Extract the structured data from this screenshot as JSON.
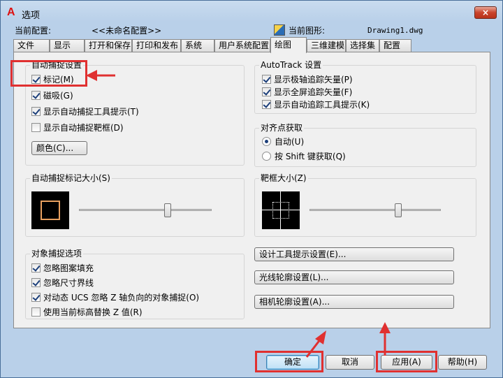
{
  "window": {
    "title": "选项",
    "close_symbol": "×"
  },
  "info": {
    "current_config_label": "当前配置:",
    "current_config_value": "<<未命名配置>>",
    "current_drawing_label": "当前图形:",
    "current_drawing_value": "Drawing1.dwg"
  },
  "tabs": [
    "文件",
    "显示",
    "打开和保存",
    "打印和发布",
    "系统",
    "用户系统配置",
    "绘图",
    "三维建模",
    "选择集",
    "配置"
  ],
  "active_tab": "绘图",
  "autosnap": {
    "title": "自动捕捉设置",
    "options": [
      {
        "label": "标记(M)",
        "checked": true
      },
      {
        "label": "磁吸(G)",
        "checked": true
      },
      {
        "label": "显示自动捕捉工具提示(T)",
        "checked": true
      },
      {
        "label": "显示自动捕捉靶框(D)",
        "checked": false
      }
    ],
    "color_button": "颜色(C)..."
  },
  "autotrack": {
    "title": "AutoTrack 设置",
    "options": [
      {
        "label": "显示极轴追踪矢量(P)",
        "checked": true
      },
      {
        "label": "显示全屏追踪矢量(F)",
        "checked": true
      },
      {
        "label": "显示自动追踪工具提示(K)",
        "checked": true
      }
    ]
  },
  "alignment": {
    "title": "对齐点获取",
    "options": [
      {
        "label": "自动(U)",
        "selected": true
      },
      {
        "label": "按 Shift 键获取(Q)",
        "selected": false
      }
    ]
  },
  "marker_size": {
    "title": "自动捕捉标记大小(S)",
    "level": 0.66,
    "marker_color": "#e8a060"
  },
  "aperture_size": {
    "title": "靶框大小(Z)",
    "level": 0.68
  },
  "osnap": {
    "title": "对象捕捉选项",
    "options": [
      {
        "label": "忽略图案填充",
        "checked": true
      },
      {
        "label": "忽略尺寸界线",
        "checked": true
      },
      {
        "label": "对动态 UCS 忽略 Z 轴负向的对象捕捉(O)",
        "checked": true
      },
      {
        "label": "使用当前标高替换 Z 值(R)",
        "checked": false
      }
    ]
  },
  "side_buttons": [
    "设计工具提示设置(E)...",
    "光线轮廓设置(L)...",
    "相机轮廓设置(A)..."
  ],
  "footer": {
    "ok": "确定",
    "cancel": "取消",
    "apply": "应用(A)",
    "help": "帮助(H)"
  },
  "annotation_color": "#e03030"
}
